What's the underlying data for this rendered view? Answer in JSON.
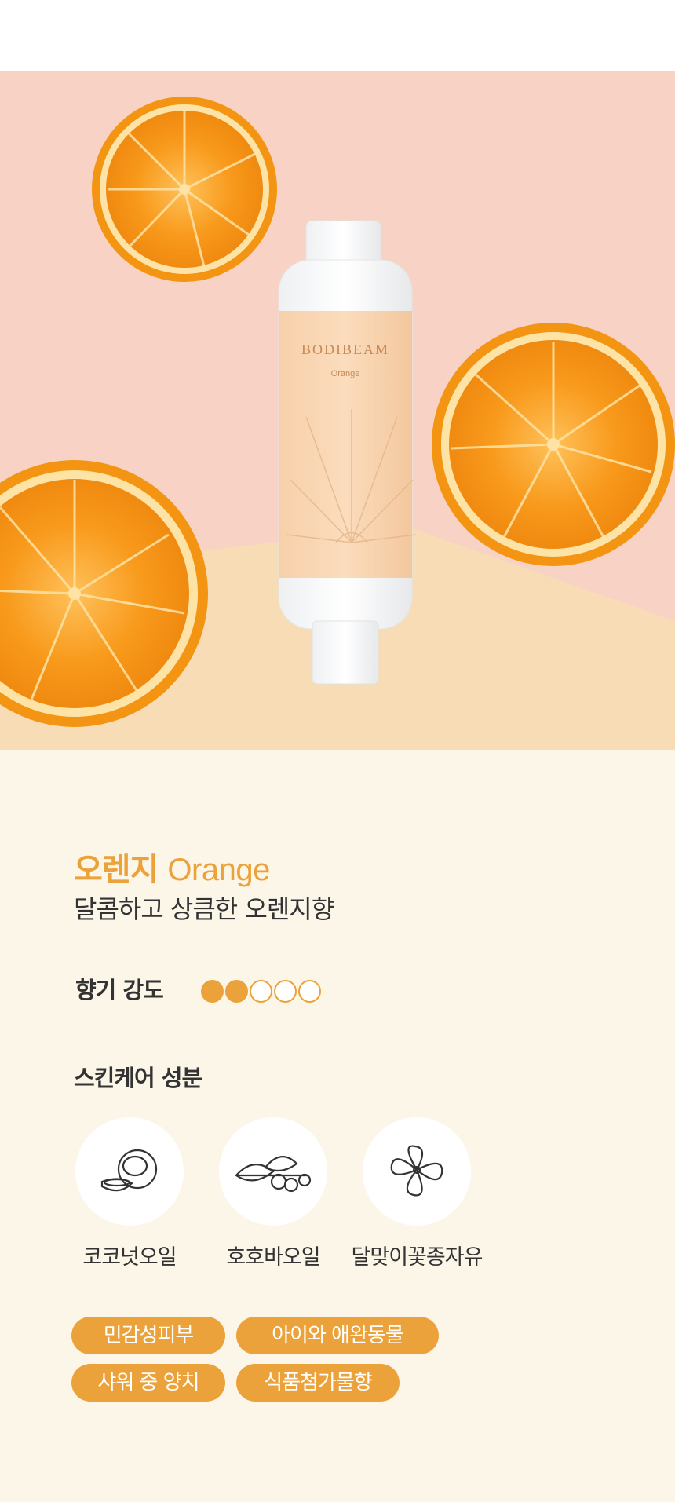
{
  "product_image": {
    "brand": "BODIBEAM",
    "variant": "Orange"
  },
  "product": {
    "name_ko": "오렌지",
    "name_en": "Orange",
    "description": "달콤하고 상큼한 오렌지향"
  },
  "intensity": {
    "label": "향기 강도",
    "level": 2,
    "max": 5
  },
  "ingredients": {
    "heading": "스킨케어 성분",
    "items": [
      {
        "label": "코코넛오일",
        "icon": "coconut-icon"
      },
      {
        "label": "호호바오일",
        "icon": "jojoba-icon"
      },
      {
        "label": "달맞이꽃종자유",
        "icon": "evening-primrose-icon"
      }
    ]
  },
  "tags": [
    {
      "label": "민감성피부"
    },
    {
      "label": "아이와 애완동물"
    },
    {
      "label": "샤워 중 양치"
    },
    {
      "label": "식품첨가물향"
    }
  ],
  "colors": {
    "accent": "#eca23a",
    "background": "#fcf6e8",
    "text": "#333333"
  }
}
